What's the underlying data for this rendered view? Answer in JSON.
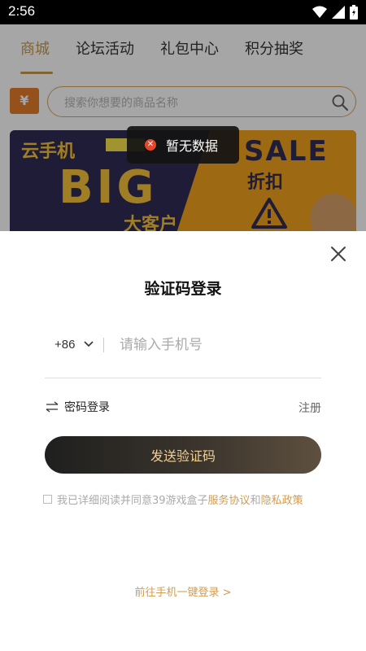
{
  "status_bar": {
    "time": "2:56"
  },
  "tabs": [
    {
      "label": "商城",
      "active": true
    },
    {
      "label": "论坛活动",
      "active": false
    },
    {
      "label": "礼包中心",
      "active": false
    },
    {
      "label": "积分抽奖",
      "active": false
    }
  ],
  "search": {
    "coupon_glyph": "¥",
    "placeholder": "搜索你想要的商品名称"
  },
  "banner": {
    "cloud_phone": "云手机",
    "big": "BIG",
    "big_customer": "大客户",
    "sale": "SALE",
    "discount": "折扣"
  },
  "toast": {
    "text": "暂无数据",
    "icon": "error-circle-icon"
  },
  "login_sheet": {
    "title": "验证码登录",
    "country_code": "+86",
    "phone_placeholder": "请输入手机号",
    "password_login": "密码登录",
    "register": "注册",
    "send_code": "发送验证码",
    "agreement_prefix": "我已详细阅读并同意39游戏盒子",
    "service_agreement": "服务协议",
    "and": "和",
    "privacy_policy": "隐私政策",
    "one_click_login": "前往手机一键登录 >"
  },
  "colors": {
    "accent_gold": "#c79a4f",
    "link_gold": "#d29c4e",
    "button_text": "#f0cf93",
    "toast_error": "#e8462b"
  }
}
